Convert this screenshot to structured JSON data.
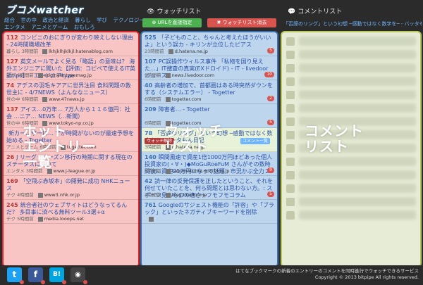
{
  "header": {
    "logo": "ブコメwatcher",
    "nav_row1": [
      "総合",
      "世の中",
      "政治と経済",
      "暮らし",
      "学び",
      "テクノロジー"
    ],
    "nav_row2": [
      "エンタメ",
      "アニメとゲーム",
      "おもしろ"
    ],
    "watchlist_title": "ウォッチリスト",
    "comment_title": "コメントリスト",
    "btn_url": "URLを直接指定",
    "btn_clear": "ウォッチリスト消去",
    "watch_entry_title": "「否諦のリング」という幻想 ─感動ではなく数字を─ - バッタもん日記"
  },
  "hot_entries": [
    {
      "count": "112",
      "title": "コンビニのおにぎりが変わり映えしない理由 - 24時間職場改革",
      "cat": "暮らし",
      "time": "3時間前",
      "domain": "lkhjklhjklkjl.hatenablog.com"
    },
    {
      "count": "127",
      "title": "英文メールでよく見る「略語」の意味は？ 海外エンジニアに聞いた【評価：コピペで使えるIT英語tips】 - エンジニアtype",
      "cat": "学び",
      "time": "6時間前",
      "domain": "engineer.typemag.jp"
    },
    {
      "count": "74",
      "title": "アデスの羽毛キアアに世界注目 食料問題の救世主に - 4/7NEWS（よんななニュース）",
      "cat": "世の中",
      "time": "6時間前",
      "domain": "www.47news.jp"
    },
    {
      "count": "137",
      "title": "アイス…0万年… 7万人から１１６億円：社会 …ニア… NEWS（…新聞）",
      "cat": "世の中",
      "time": "6時間前",
      "domain": "www.tokyo-np.co.jp"
    },
    {
      "count": "",
      "title": "新カー…ザーに… \"\"が時間がないのが最速予想を始める - Togetter",
      "cat": "アニメとゲーム",
      "time": "6時間前",
      "domain": "togetter.com"
    },
    {
      "count": "26",
      "title": "J リーグ・シーズン移行の時期に関する現在のステータスについて",
      "cat": "エンタメ",
      "time": "3時間前",
      "domain": "www.j-league.or.jp"
    },
    {
      "count": "169",
      "title": "「空飛ぶ赤坂本」の開発に成功 NHKニュース",
      "cat": "テク",
      "time": "4時間前",
      "domain": "www3.nhk.or.jp"
    },
    {
      "count": "245",
      "title": "統合者社のウェブサイトはどうなってるんだ？ 多目事に済べる無料ツール3選+α",
      "cat": "テク",
      "time": "5時間前",
      "domain": "media.looops.net"
    }
  ],
  "watch_entries": [
    {
      "count": "525",
      "title": "「子どものこと、ちゃんと考えたほうがいいよ」という誤カ - キリンが立位したピアス",
      "time": "23時間前",
      "domain": "d.hatena.ne.jp",
      "badge": "5"
    },
    {
      "count": "107",
      "title": "PC誤操作ウィルス事件 「私物を国り見えた…」IT捜査の真実(EXドロイド) - IT - livedoor ニュース",
      "time": "9時間前",
      "domain": "news.livedoor.com",
      "badge": "10"
    },
    {
      "count": "40",
      "title": "高齢者の増加で、首都圏はある時突然ダウンをする（システムエラー） - Togetter",
      "time": "6時間前",
      "domain": "togetter.com",
      "badge": "2"
    },
    {
      "count": "209",
      "title": "障害者… - Togetter",
      "time": "6時間前",
      "domain": "togetter.com",
      "badge": "5"
    },
    {
      "count": "78",
      "title": "「否諦のリング」という幻想 ─感動ではなく数字を─ - バッタもん日記",
      "time": "3時間前",
      "domain": "d.hatena.ne.jp",
      "badge": "",
      "btn_del": "ウォッチ解除",
      "btn_cm": "コメント一覧"
    },
    {
      "count": "140",
      "title": "瞬間風速で資産1倍1000万円ほどあった個人投資家の(・∀・)◆MoGuRoeFuM さんがその数時間後に資産21万円になって話題：市況かぶ全力２階建",
      "time": "8時間前",
      "domain": "kabumatome.doorblog.jp",
      "badge": "9"
    },
    {
      "count": "42",
      "title": "読一律の反発保護を正したということ、それを何せていたことを、何ら問題とは思わない方。: スポーツ見るものの適さ～フモフモコラム",
      "time": "4時間前",
      "domain": "blog.livedoor.jp",
      "badge": "5"
    },
    {
      "count": "761",
      "title": "Googleのサジェスト機能の「許容」や「ブラック」といったネガティブキーワードを削除",
      "time": "",
      "domain": "",
      "badge": ""
    }
  ],
  "overlays": {
    "hot": [
      "ホット",
      "エントリー",
      "一覧"
    ],
    "watch": [
      "ウォッチ",
      "リスト"
    ],
    "comment": [
      "コメント",
      "リスト"
    ]
  },
  "footer": {
    "line1": "はてなブックマークの新着のエントリーのコメントを同時進行でウォッチできるサービス",
    "line2": "Copyright © 2013 bitpipe All rights reserved.",
    "social": [
      {
        "name": "twitter",
        "glyph": "t",
        "color": "#1da1f2"
      },
      {
        "name": "facebook",
        "glyph": "f",
        "color": "#3b5998"
      },
      {
        "name": "hatena-bookmark",
        "glyph": "B!",
        "color": "#00a4de"
      },
      {
        "name": "github",
        "glyph": "◉",
        "color": "#444444"
      }
    ]
  }
}
